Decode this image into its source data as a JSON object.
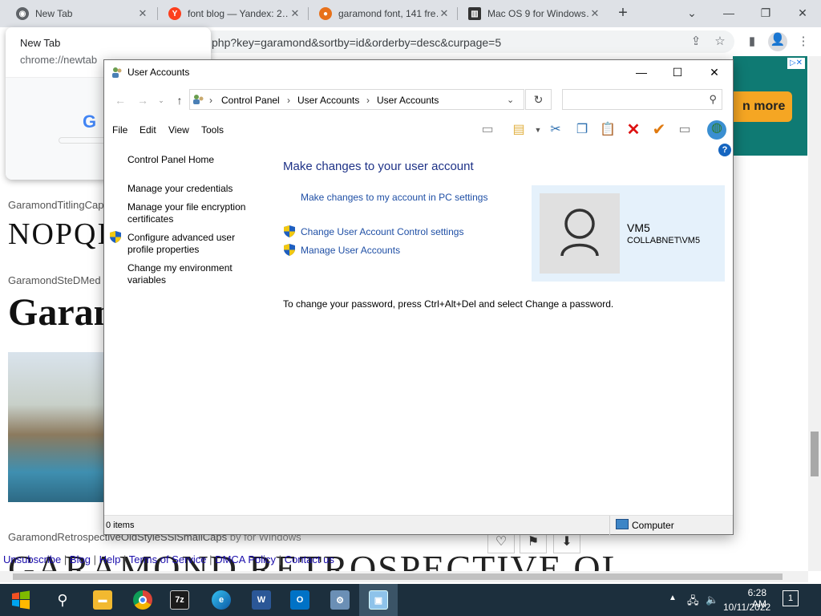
{
  "browser": {
    "tabs": [
      {
        "title": "New Tab",
        "favicon": "chrome-icon"
      },
      {
        "title": "font blog — Yandex: 2…",
        "favicon": "yandex-icon"
      },
      {
        "title": "garamond font, 141 fre…",
        "favicon": "site-icon"
      },
      {
        "title": "Mac OS 9 for Windows…",
        "favicon": "museum-icon"
      }
    ],
    "url": "php?key=garamond&sortby=id&orderby=desc&curpage=5",
    "hovercard": {
      "title": "New Tab",
      "url": "chrome://newtab"
    }
  },
  "page": {
    "font_items": [
      {
        "name": "GaramondTitlingCap…",
        "sample": "NOPQI"
      },
      {
        "name": "GaramondSteDMed",
        "sample": "Garan"
      }
    ],
    "bottom_font_name": "GaramondRetrospectiveOldStyleSSiSmallCaps",
    "bottom_font_by": "by for Windows",
    "big_sample": "GARAMOND RETROSPECTIVE OL",
    "ad_button": "n more",
    "footer_links": [
      "Unsubscribe",
      "Blog",
      "Help",
      "Terms of Service",
      "DMCA Policy",
      "Contact us"
    ]
  },
  "window": {
    "title": "User Accounts",
    "breadcrumb": [
      "Control Panel",
      "User Accounts",
      "User Accounts"
    ],
    "menu": [
      "File",
      "Edit",
      "View",
      "Tools"
    ],
    "sidebar": {
      "home": "Control Panel Home",
      "links": [
        "Manage your credentials",
        "Manage your file encryption certificates",
        "Configure advanced user profile properties",
        "Change my environment variables"
      ]
    },
    "main": {
      "heading": "Make changes to your user account",
      "pc_settings_link": "Make changes to my account in PC settings",
      "uac_link": "Change User Account Control settings",
      "manage_link": "Manage User Accounts",
      "password_note": "To change your password, press Ctrl+Alt+Del and select Change a password."
    },
    "user": {
      "name": "VM5",
      "domain": "COLLABNET\\VM5"
    },
    "status": {
      "items": "0 items",
      "zone": "Computer"
    }
  },
  "taskbar": {
    "time": "6:28 AM",
    "date": "10/11/2022",
    "notification_count": "1",
    "apps": [
      "start",
      "search",
      "file-explorer",
      "chrome",
      "7zip",
      "edge",
      "word",
      "outlook",
      "control-panel",
      "user-accounts"
    ]
  },
  "colors": {
    "taskbar": "#1c2f3d",
    "link": "#1f4fa5",
    "heading": "#1e3287",
    "user_card": "#e5f1fb"
  }
}
